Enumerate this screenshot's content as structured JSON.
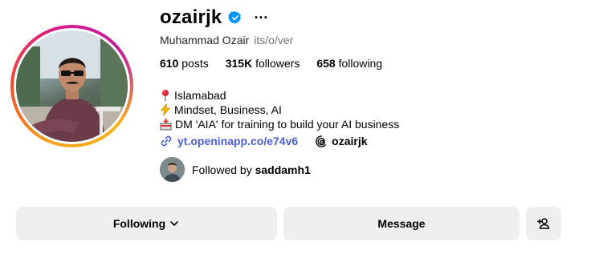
{
  "profile": {
    "username": "ozairjk",
    "full_name": "Muhammad Ozair",
    "pronouns": "its/o/ver",
    "more_label": "···"
  },
  "stats": {
    "posts": "610",
    "posts_label": "posts",
    "followers": "315K",
    "followers_label": "followers",
    "following": "658",
    "following_label": "following"
  },
  "bio": {
    "line1": "Islamabad",
    "line2": "Mindset, Business, AI",
    "line3": "DM 'AIA' for training to build your AI business",
    "link": "yt.openinapp.co/e74v6",
    "threads_handle": "ozairjk"
  },
  "followed_by": {
    "prefix": "Followed by",
    "user": "saddamh1"
  },
  "actions": {
    "following_label": "Following",
    "message_label": "Message"
  },
  "icons": {
    "verified": "verified-badge-icon",
    "more": "more-options-icon",
    "pin": "round-pushpin-icon",
    "bolt": "lightning-icon",
    "inbox": "inbox-tray-icon",
    "link": "link-icon",
    "threads": "threads-icon",
    "chevron": "chevron-down-icon",
    "add_user": "add-user-icon"
  },
  "colors": {
    "verified_blue": "#0095f6",
    "link_blue": "#4a5dd8",
    "button_bg": "#efefef",
    "secondary_text": "#737373"
  }
}
